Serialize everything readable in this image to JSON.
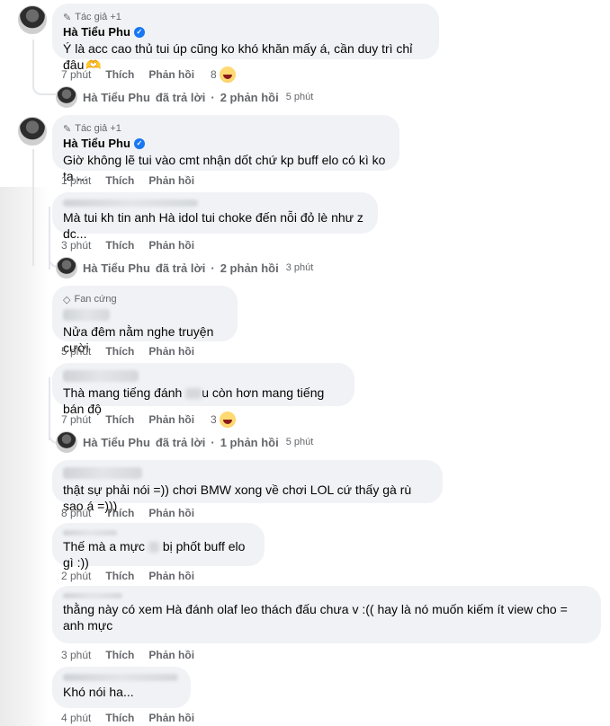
{
  "comments": [
    {
      "badge": "Tác giả +1",
      "author": "Hà Tiểu Phu",
      "verified": true,
      "text": "Ý là acc cao thủ tui úp cũng ko khó khăn mấy á, cần duy trì chỉ đâu",
      "trailing_emoji": "🫶",
      "time": "7 phút",
      "like": "Thích",
      "reply": "Phản hồi",
      "reactions": "8",
      "reaction_icon": "laugh-emoji"
    },
    {
      "badge": "Tác giả +1",
      "author": "Hà Tiểu Phu",
      "verified": true,
      "text": "Giờ không lẽ tui vào cmt nhận dốt chứ kp buff elo có kì ko ta ...",
      "time": "1 phút",
      "like": "Thích",
      "reply": "Phản hồi"
    },
    {
      "text": "Mà tui kh tin anh Hà idol tui choke đến nỗi đỏ lè như z dc...",
      "time": "3 phút",
      "like": "Thích",
      "reply": "Phản hồi"
    },
    {
      "badge": "Fan cứng",
      "text": "Nửa đêm nằm nghe truyện cười",
      "time": "5 phút",
      "like": "Thích",
      "reply": "Phản hồi"
    },
    {
      "text_before": "Thà mang tiếng đánh",
      "text_after": "u còn hơn mang tiếng bán độ",
      "time": "7 phút",
      "like": "Thích",
      "reply": "Phản hồi",
      "reactions": "3",
      "reaction_icon": "laugh-emoji"
    },
    {
      "text": "thật sự phải nói =)) chơi BMW xong về chơi LOL cứ thấy gà rù sao á =)))",
      "time": "8 phút",
      "like": "Thích",
      "reply": "Phản hồi"
    },
    {
      "text_before": "Thế mà a mực",
      "text_after": "bị phốt buff elo gì :))",
      "time": "2 phút",
      "like": "Thích",
      "reply": "Phản hồi"
    },
    {
      "text": "thằng này có xem Hà đánh olaf leo thách đấu chưa v :(( hay là nó muốn kiếm ít view cho = anh mực",
      "time": "3 phút",
      "like": "Thích",
      "reply": "Phản hồi"
    },
    {
      "text": "Khó nói ha...",
      "time": "4 phút",
      "like": "Thích",
      "reply": "Phản hồi"
    }
  ],
  "reply_links": [
    {
      "name": "Hà Tiểu Phu",
      "action": "đã trả lời",
      "count": "2 phản hồi",
      "time": "5 phút"
    },
    {
      "name": "Hà Tiểu Phu",
      "action": "đã trả lời",
      "count": "2 phản hồi",
      "time": "3 phút"
    },
    {
      "name": "Hà Tiểu Phu",
      "action": "đã trả lời",
      "count": "1 phản hồi",
      "time": "5 phút"
    }
  ],
  "icons": {
    "author_badge": "pencil-icon",
    "fan_badge": "diamond-icon",
    "verified": "verified-check-icon"
  },
  "colors": {
    "bubble": "#f0f2f5",
    "meta_text": "#65676b",
    "verified": "#1877f2"
  }
}
